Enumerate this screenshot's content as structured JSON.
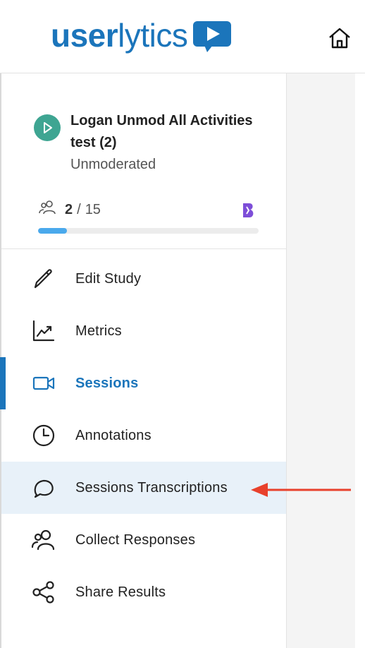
{
  "header": {
    "logo_text_bold": "user",
    "logo_text_light": "lytics",
    "home_icon": "home-icon",
    "brand_color": "#1b75bb"
  },
  "study": {
    "title": "Logan Unmod All Activities test (2)",
    "type": "Unmoderated",
    "participants_current": "2",
    "participants_separator": "/",
    "participants_total": "15",
    "progress_fraction": 0.13,
    "status_icon": "play-icon",
    "status_color": "#3ea592"
  },
  "nav": {
    "items": [
      {
        "label": "Edit Study",
        "icon": "pencil-icon"
      },
      {
        "label": "Metrics",
        "icon": "chart-trend-icon"
      },
      {
        "label": "Sessions",
        "icon": "video-camera-icon",
        "active": true
      },
      {
        "label": "Annotations",
        "icon": "clock-icon"
      },
      {
        "label": "Sessions Transcriptions",
        "icon": "chat-bubble-icon",
        "highlighted": true
      },
      {
        "label": "Collect Responses",
        "icon": "users-icon"
      },
      {
        "label": "Share Results",
        "icon": "share-icon"
      }
    ]
  },
  "annotation": {
    "arrow_color": "#e8412c"
  }
}
